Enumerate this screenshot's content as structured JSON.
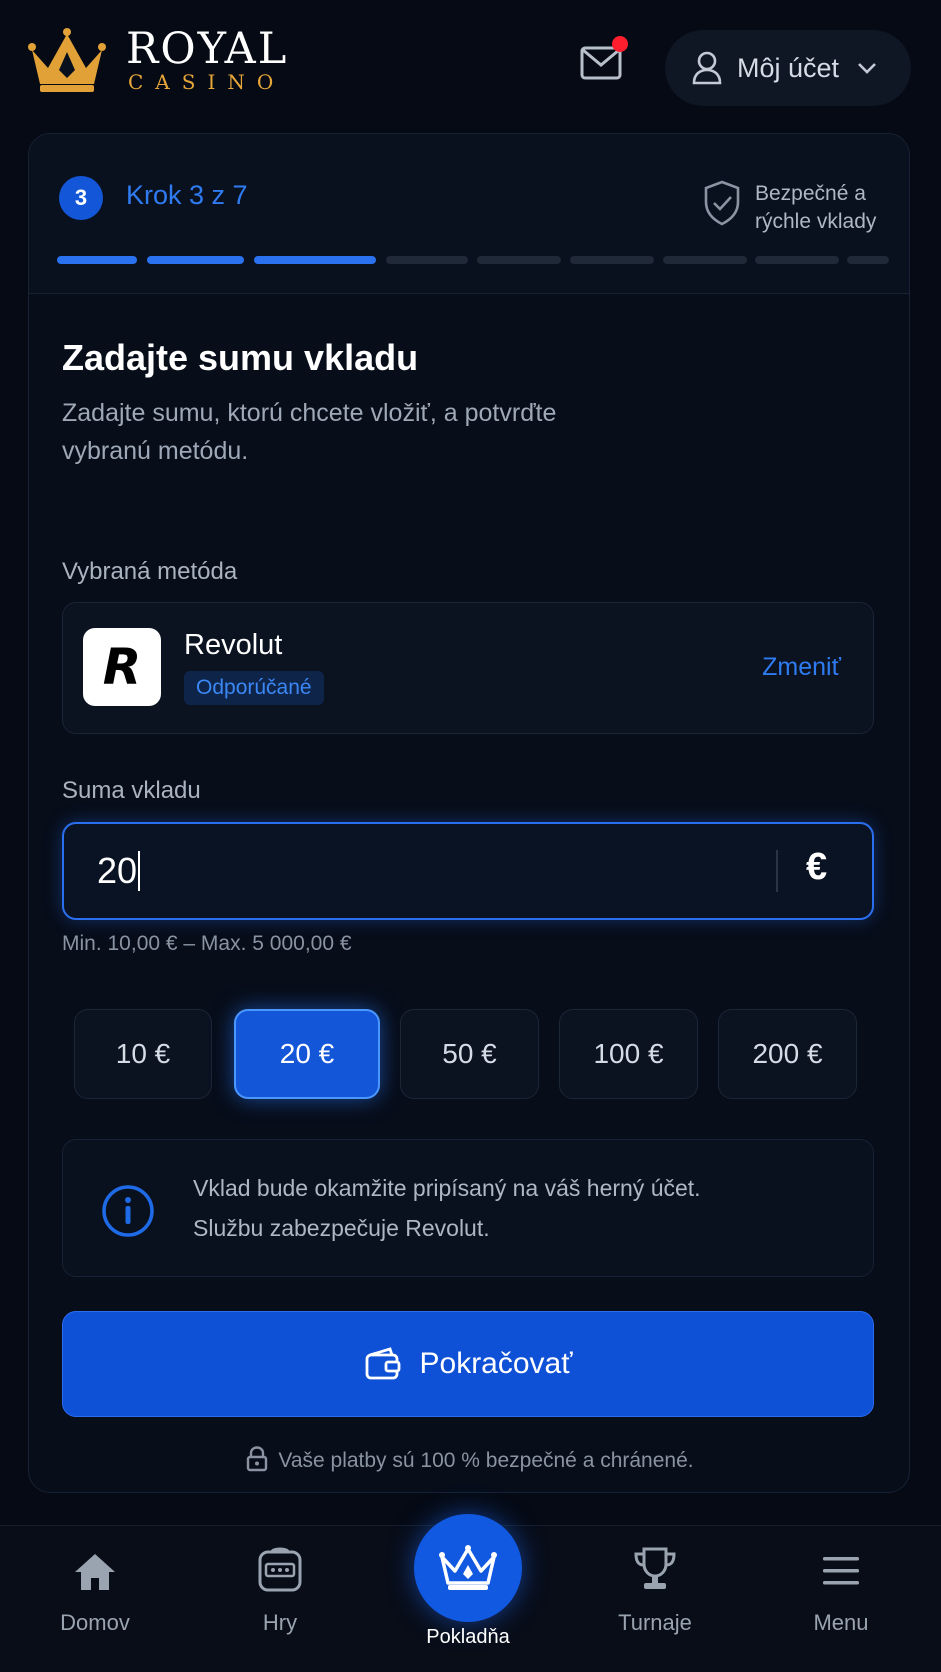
{
  "header": {
    "logo_royal": "ROYAL",
    "logo_casino": "CASINO",
    "account_label": "Môj účet"
  },
  "steps": {
    "current": "3",
    "label": "Krok 3 z 7",
    "secure_text": "Bezpečné a rýchle vklady",
    "progress": {
      "completed": 3,
      "total": 7
    }
  },
  "form": {
    "title": "Zadajte sumu vkladu",
    "subtitle": "Zadajte sumu, ktorú chcete vložiť, a potvrďte vybranú metódu.",
    "method_label": "Vybraná metóda",
    "method": {
      "logo_letter": "R",
      "name": "Revolut",
      "badge": "Odporúčané",
      "change": "Zmeniť"
    },
    "amount_label": "Suma vkladu",
    "amount_value": "20",
    "currency": "€",
    "limits": "Min. 10,00 € – Max. 5 000,00 €",
    "quick_amounts": [
      "10 €",
      "20 €",
      "50 €",
      "100 €",
      "200 €"
    ],
    "quick_selected": "20 €",
    "info_line1": "Vklad bude okamžite pripísaný na váš herný účet.",
    "info_line2": "Službu zabezpečuje Revolut.",
    "cta": "Pokračovať",
    "secure_note": "Vaše platby sú 100 % bezpečné a chránené."
  },
  "nav": {
    "home": "Domov",
    "games": "Hry",
    "cashier": "Pokladňa",
    "tournaments": "Turnaje",
    "menu": "Menu"
  },
  "colors": {
    "accent": "#1456d8",
    "link": "#2f7bf2",
    "gold": "#e7a63a",
    "notification": "#ff1e2d",
    "background": "#050a14"
  }
}
